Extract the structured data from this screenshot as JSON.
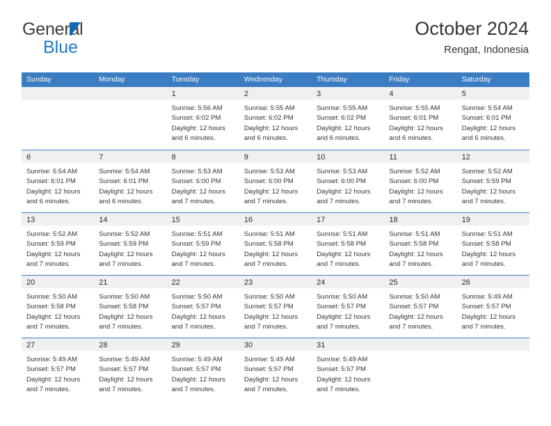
{
  "logo": {
    "word_primary": "General",
    "word_secondary": "Blue",
    "triangle_color": "#1069b4",
    "primary_color": "#3c3c3c",
    "secondary_color": "#1f7ac4"
  },
  "header": {
    "title": "October 2024",
    "subtitle": "Rengat, Indonesia"
  },
  "theme": {
    "header_blue": "#3b7dc2",
    "daynum_band": "#f0f0f0",
    "text": "#333333"
  },
  "weekdays": [
    "Sunday",
    "Monday",
    "Tuesday",
    "Wednesday",
    "Thursday",
    "Friday",
    "Saturday"
  ],
  "weeks": [
    [
      {
        "day": ""
      },
      {
        "day": ""
      },
      {
        "day": "1",
        "sunrise": "Sunrise: 5:56 AM",
        "sunset": "Sunset: 6:02 PM",
        "daylight1": "Daylight: 12 hours",
        "daylight2": "and 6 minutes."
      },
      {
        "day": "2",
        "sunrise": "Sunrise: 5:55 AM",
        "sunset": "Sunset: 6:02 PM",
        "daylight1": "Daylight: 12 hours",
        "daylight2": "and 6 minutes."
      },
      {
        "day": "3",
        "sunrise": "Sunrise: 5:55 AM",
        "sunset": "Sunset: 6:02 PM",
        "daylight1": "Daylight: 12 hours",
        "daylight2": "and 6 minutes."
      },
      {
        "day": "4",
        "sunrise": "Sunrise: 5:55 AM",
        "sunset": "Sunset: 6:01 PM",
        "daylight1": "Daylight: 12 hours",
        "daylight2": "and 6 minutes."
      },
      {
        "day": "5",
        "sunrise": "Sunrise: 5:54 AM",
        "sunset": "Sunset: 6:01 PM",
        "daylight1": "Daylight: 12 hours",
        "daylight2": "and 6 minutes."
      }
    ],
    [
      {
        "day": "6",
        "sunrise": "Sunrise: 5:54 AM",
        "sunset": "Sunset: 6:01 PM",
        "daylight1": "Daylight: 12 hours",
        "daylight2": "and 6 minutes."
      },
      {
        "day": "7",
        "sunrise": "Sunrise: 5:54 AM",
        "sunset": "Sunset: 6:01 PM",
        "daylight1": "Daylight: 12 hours",
        "daylight2": "and 6 minutes."
      },
      {
        "day": "8",
        "sunrise": "Sunrise: 5:53 AM",
        "sunset": "Sunset: 6:00 PM",
        "daylight1": "Daylight: 12 hours",
        "daylight2": "and 7 minutes."
      },
      {
        "day": "9",
        "sunrise": "Sunrise: 5:53 AM",
        "sunset": "Sunset: 6:00 PM",
        "daylight1": "Daylight: 12 hours",
        "daylight2": "and 7 minutes."
      },
      {
        "day": "10",
        "sunrise": "Sunrise: 5:53 AM",
        "sunset": "Sunset: 6:00 PM",
        "daylight1": "Daylight: 12 hours",
        "daylight2": "and 7 minutes."
      },
      {
        "day": "11",
        "sunrise": "Sunrise: 5:52 AM",
        "sunset": "Sunset: 6:00 PM",
        "daylight1": "Daylight: 12 hours",
        "daylight2": "and 7 minutes."
      },
      {
        "day": "12",
        "sunrise": "Sunrise: 5:52 AM",
        "sunset": "Sunset: 5:59 PM",
        "daylight1": "Daylight: 12 hours",
        "daylight2": "and 7 minutes."
      }
    ],
    [
      {
        "day": "13",
        "sunrise": "Sunrise: 5:52 AM",
        "sunset": "Sunset: 5:59 PM",
        "daylight1": "Daylight: 12 hours",
        "daylight2": "and 7 minutes."
      },
      {
        "day": "14",
        "sunrise": "Sunrise: 5:52 AM",
        "sunset": "Sunset: 5:59 PM",
        "daylight1": "Daylight: 12 hours",
        "daylight2": "and 7 minutes."
      },
      {
        "day": "15",
        "sunrise": "Sunrise: 5:51 AM",
        "sunset": "Sunset: 5:59 PM",
        "daylight1": "Daylight: 12 hours",
        "daylight2": "and 7 minutes."
      },
      {
        "day": "16",
        "sunrise": "Sunrise: 5:51 AM",
        "sunset": "Sunset: 5:58 PM",
        "daylight1": "Daylight: 12 hours",
        "daylight2": "and 7 minutes."
      },
      {
        "day": "17",
        "sunrise": "Sunrise: 5:51 AM",
        "sunset": "Sunset: 5:58 PM",
        "daylight1": "Daylight: 12 hours",
        "daylight2": "and 7 minutes."
      },
      {
        "day": "18",
        "sunrise": "Sunrise: 5:51 AM",
        "sunset": "Sunset: 5:58 PM",
        "daylight1": "Daylight: 12 hours",
        "daylight2": "and 7 minutes."
      },
      {
        "day": "19",
        "sunrise": "Sunrise: 5:51 AM",
        "sunset": "Sunset: 5:58 PM",
        "daylight1": "Daylight: 12 hours",
        "daylight2": "and 7 minutes."
      }
    ],
    [
      {
        "day": "20",
        "sunrise": "Sunrise: 5:50 AM",
        "sunset": "Sunset: 5:58 PM",
        "daylight1": "Daylight: 12 hours",
        "daylight2": "and 7 minutes."
      },
      {
        "day": "21",
        "sunrise": "Sunrise: 5:50 AM",
        "sunset": "Sunset: 5:58 PM",
        "daylight1": "Daylight: 12 hours",
        "daylight2": "and 7 minutes."
      },
      {
        "day": "22",
        "sunrise": "Sunrise: 5:50 AM",
        "sunset": "Sunset: 5:57 PM",
        "daylight1": "Daylight: 12 hours",
        "daylight2": "and 7 minutes."
      },
      {
        "day": "23",
        "sunrise": "Sunrise: 5:50 AM",
        "sunset": "Sunset: 5:57 PM",
        "daylight1": "Daylight: 12 hours",
        "daylight2": "and 7 minutes."
      },
      {
        "day": "24",
        "sunrise": "Sunrise: 5:50 AM",
        "sunset": "Sunset: 5:57 PM",
        "daylight1": "Daylight: 12 hours",
        "daylight2": "and 7 minutes."
      },
      {
        "day": "25",
        "sunrise": "Sunrise: 5:50 AM",
        "sunset": "Sunset: 5:57 PM",
        "daylight1": "Daylight: 12 hours",
        "daylight2": "and 7 minutes."
      },
      {
        "day": "26",
        "sunrise": "Sunrise: 5:49 AM",
        "sunset": "Sunset: 5:57 PM",
        "daylight1": "Daylight: 12 hours",
        "daylight2": "and 7 minutes."
      }
    ],
    [
      {
        "day": "27",
        "sunrise": "Sunrise: 5:49 AM",
        "sunset": "Sunset: 5:57 PM",
        "daylight1": "Daylight: 12 hours",
        "daylight2": "and 7 minutes."
      },
      {
        "day": "28",
        "sunrise": "Sunrise: 5:49 AM",
        "sunset": "Sunset: 5:57 PM",
        "daylight1": "Daylight: 12 hours",
        "daylight2": "and 7 minutes."
      },
      {
        "day": "29",
        "sunrise": "Sunrise: 5:49 AM",
        "sunset": "Sunset: 5:57 PM",
        "daylight1": "Daylight: 12 hours",
        "daylight2": "and 7 minutes."
      },
      {
        "day": "30",
        "sunrise": "Sunrise: 5:49 AM",
        "sunset": "Sunset: 5:57 PM",
        "daylight1": "Daylight: 12 hours",
        "daylight2": "and 7 minutes."
      },
      {
        "day": "31",
        "sunrise": "Sunrise: 5:49 AM",
        "sunset": "Sunset: 5:57 PM",
        "daylight1": "Daylight: 12 hours",
        "daylight2": "and 7 minutes."
      },
      {
        "day": ""
      },
      {
        "day": ""
      }
    ]
  ]
}
